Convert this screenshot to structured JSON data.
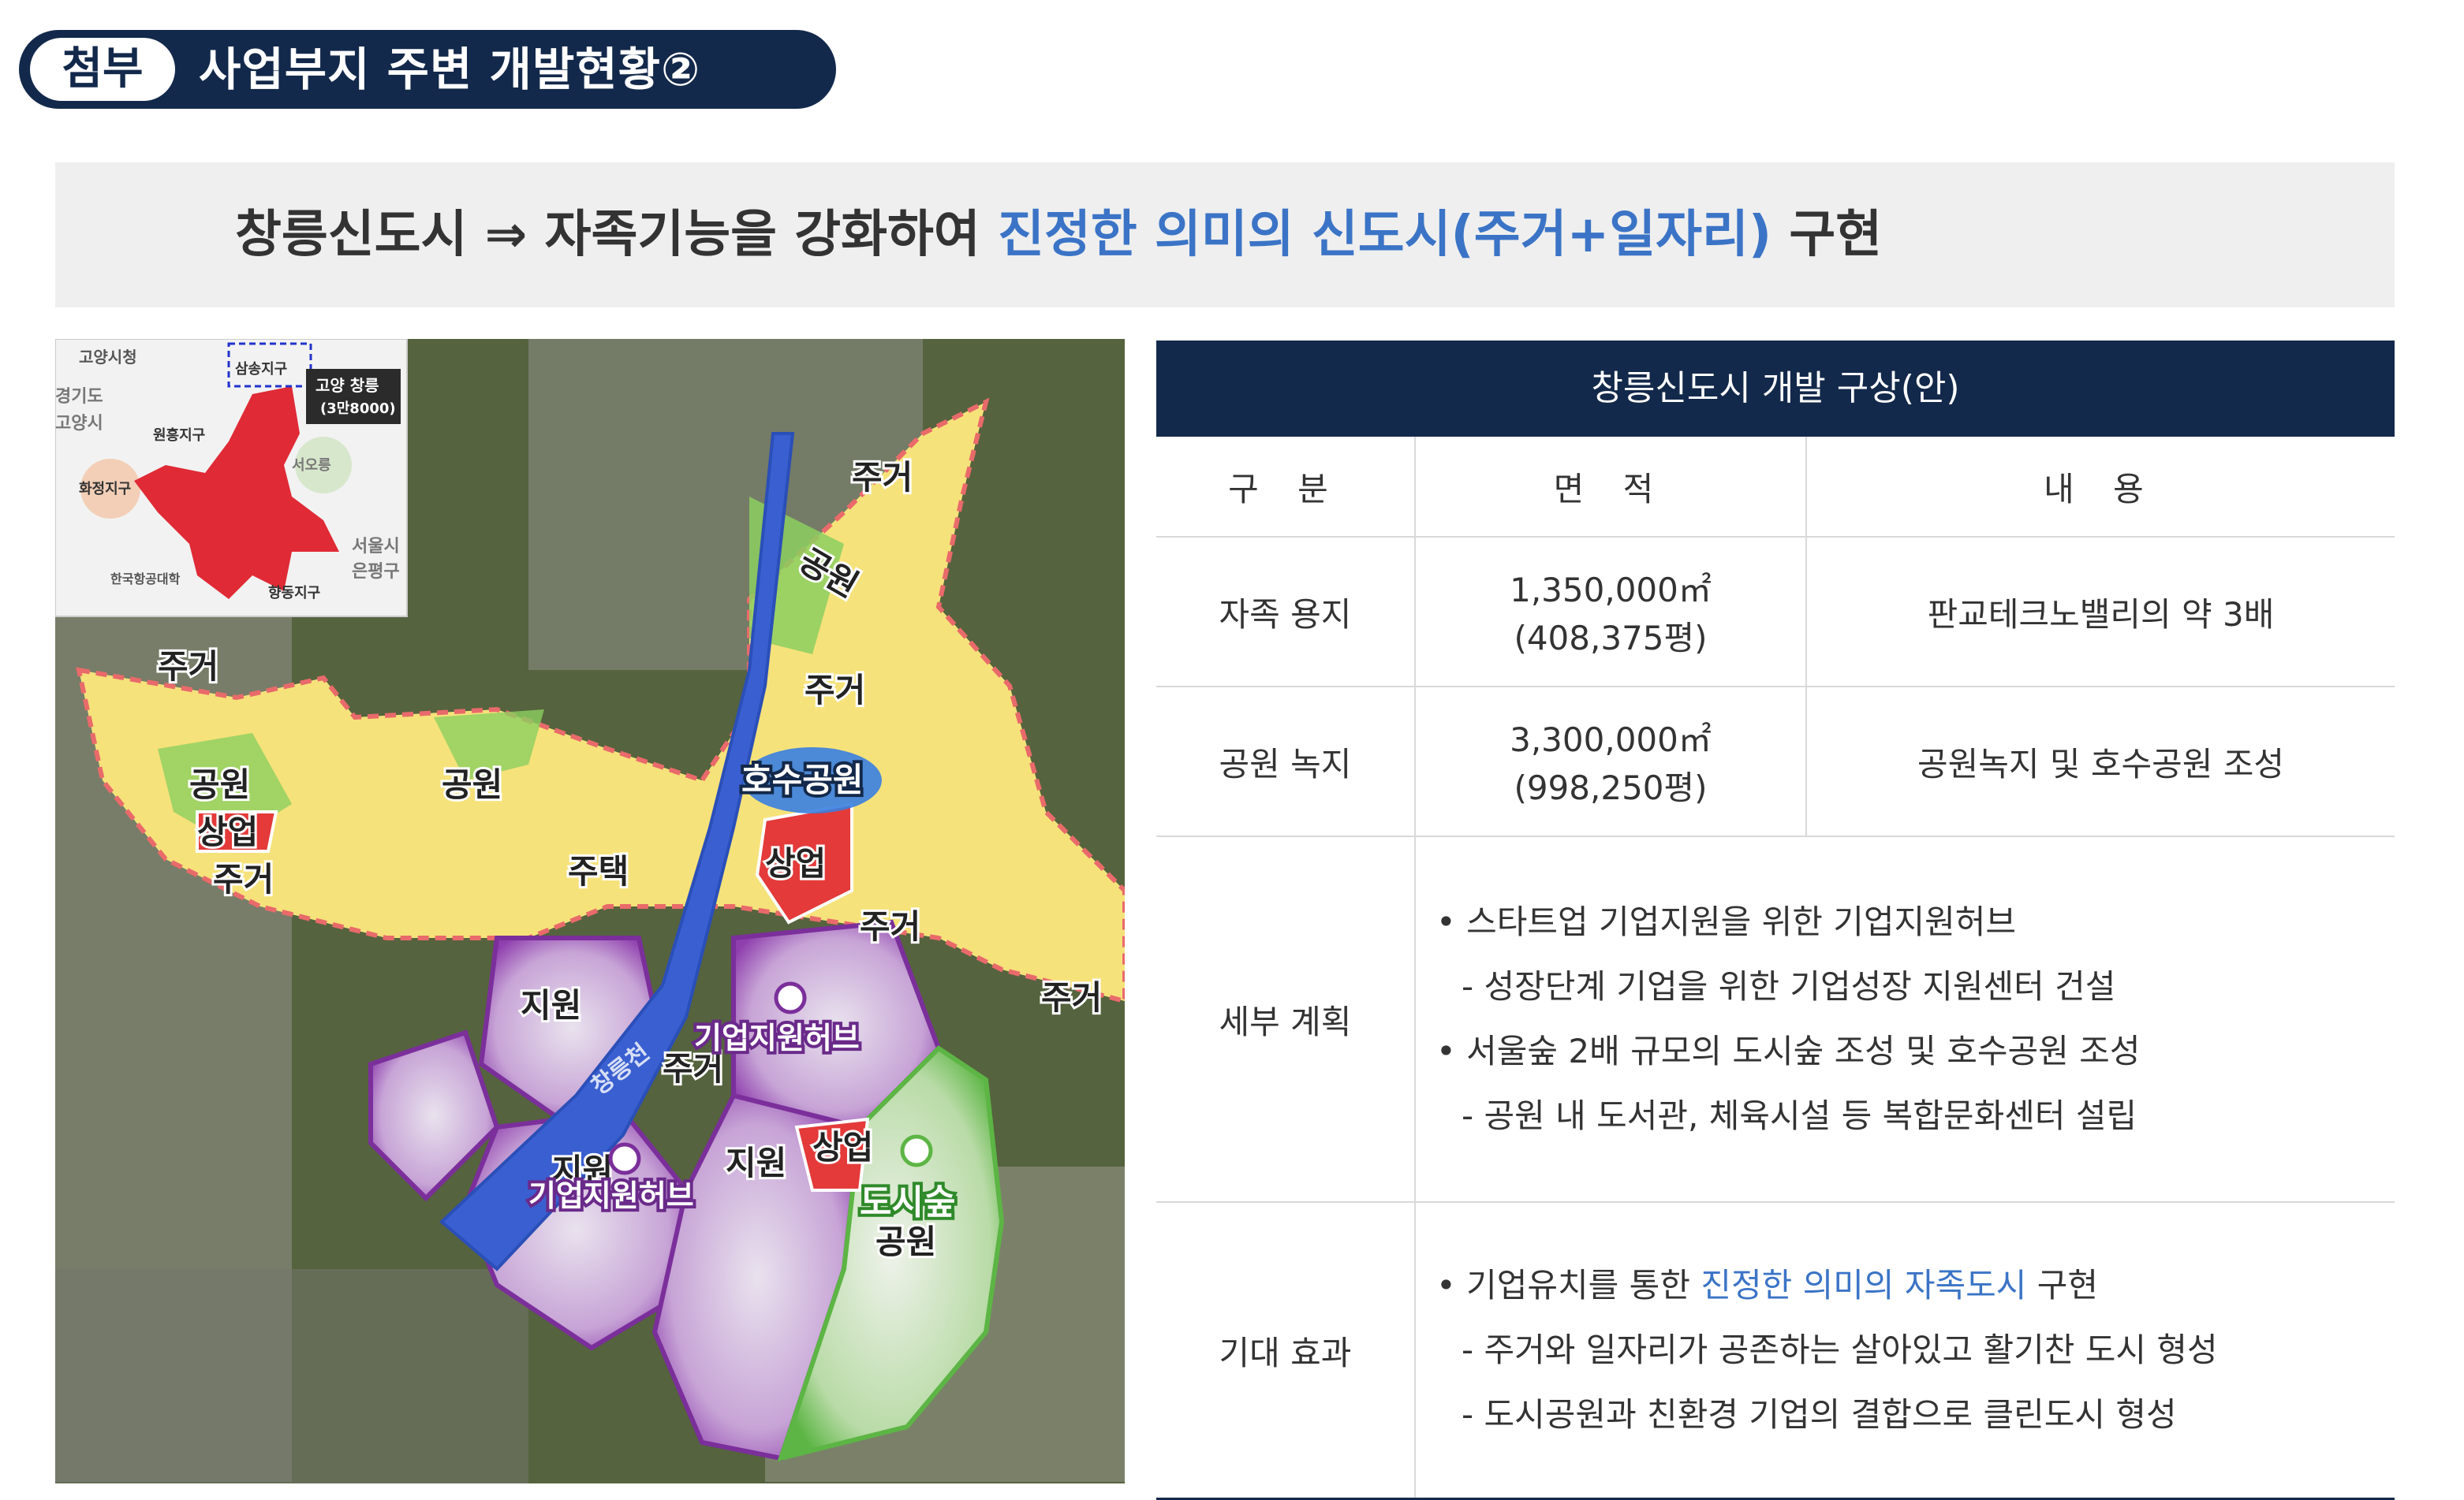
{
  "header": {
    "tag": "첨부",
    "title": "사업부지 주변 개발현황②"
  },
  "banner": {
    "part1": "창릉신도시 ⇒ 자족기능을 강화하여 ",
    "highlight": "진정한 의미의 신도시(주거+일자리)",
    "part2": " 구현"
  },
  "map": {
    "inset": {
      "places": [
        "고양시청",
        "삼송지구",
        "고양 창릉",
        "(3만8000)",
        "경기도",
        "고양시",
        "원흥지구",
        "서오릉",
        "화정지구",
        "서울시",
        "은평구",
        "한국항공대학",
        "향동지구"
      ]
    },
    "zones": {
      "housing": "주거",
      "park": "공원",
      "commercial": "상업",
      "house": "주택",
      "support": "지원",
      "lake_park": "호수공원",
      "hub": "기업지원허브",
      "city_forest": "도시숲",
      "stream": "창릉천"
    },
    "colors": {
      "housing": "#f6e27a",
      "park": "#7cc35a",
      "commercial": "#e43a3a",
      "support": "#9b59b6",
      "stream": "#3a5fd0",
      "navy": "#13294b"
    }
  },
  "table": {
    "title": "창릉신도시 개발 구상(안)",
    "columns": [
      "구 분",
      "면 적",
      "내 용"
    ],
    "rows": {
      "land": {
        "label": "자족 용지",
        "area1": "1,350,000㎡",
        "area2": "(408,375평)",
        "content": "판교테크노밸리의 약 3배"
      },
      "park": {
        "label": "공원 녹지",
        "area1": "3,300,000㎡",
        "area2": "(998,250평)",
        "content": "공원녹지 및 호수공원 조성"
      },
      "detail": {
        "label": "세부 계획",
        "lines": [
          "• 스타트업 기업지원을 위한 기업지원허브",
          "- 성장단계 기업을 위한 기업성장 지원센터 건설",
          "• 서울숲 2배 규모의 도시숲 조성 및 호수공원 조성",
          "- 공원 내 도서관, 체육시설 등 복합문화센터 설립"
        ]
      },
      "effect": {
        "label": "기대 효과",
        "line1_a": "• 기업유치를 통한 ",
        "line1_hl": "진정한 의미의 자족도시",
        "line1_b": " 구현",
        "line2": "- 주거와 일자리가 공존하는 살아있고 활기찬 도시 형성",
        "line3": "- 도시공원과 친환경 기업의 결합으로 클린도시 형성"
      }
    }
  }
}
